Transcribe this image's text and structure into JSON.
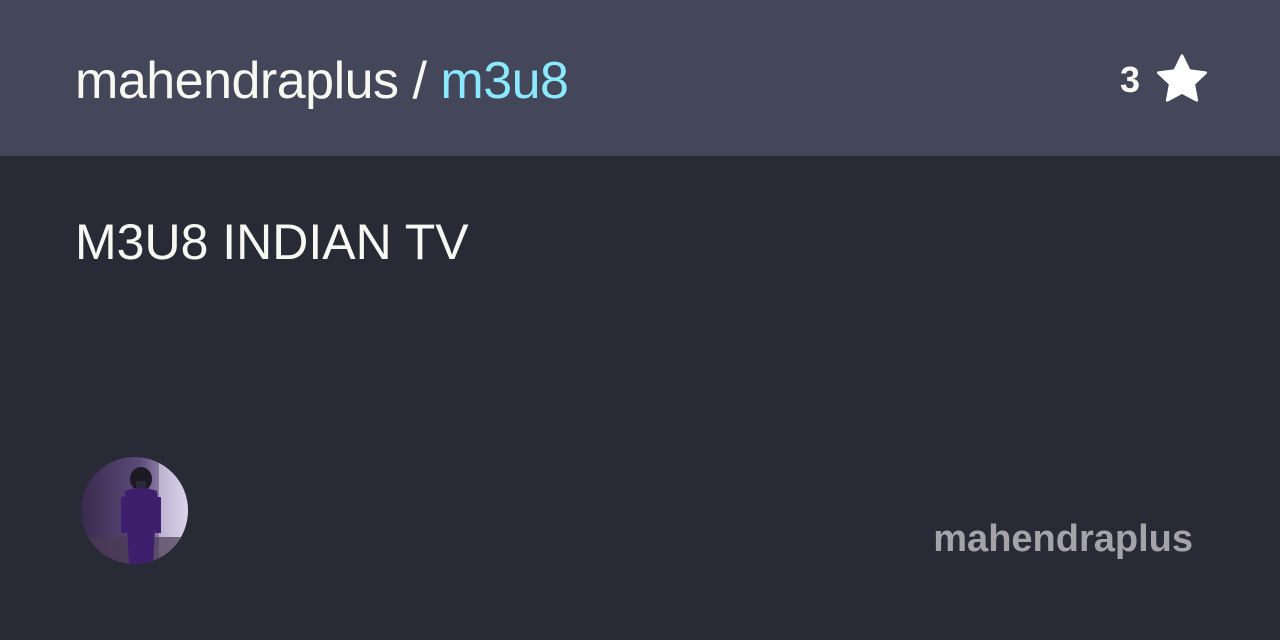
{
  "header": {
    "owner": "mahendraplus",
    "separator": " / ",
    "repo": "m3u8"
  },
  "stars": {
    "count": "3",
    "icon": "star-icon"
  },
  "description": "M3U8 INDIAN TV",
  "footer": {
    "avatar_icon": "avatar-image",
    "owner_label": "mahendraplus"
  },
  "colors": {
    "background": "#282a36",
    "header_background": "#44475a",
    "repo_accent": "#8be9fd",
    "text": "#f8f8f2",
    "muted_text": "#a3a3a8"
  }
}
